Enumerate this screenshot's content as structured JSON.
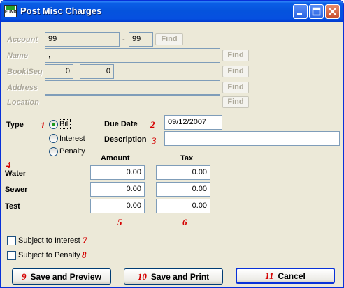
{
  "window": {
    "title": "Post Misc Charges",
    "icon_name": "fund-app-icon",
    "icon_text": "FUND",
    "controls": [
      "minimize-icon",
      "maximize-icon",
      "close-icon"
    ]
  },
  "lookup": {
    "account_label": "Account",
    "account_value": "99",
    "account_sep": "-",
    "account_suffix": "99",
    "name_label": "Name",
    "name_value": ",",
    "bookseq_label": "Book\\Seq",
    "book_value": "0",
    "seq_value": "0",
    "address_label": "Address",
    "address_value": "",
    "location_label": "Location",
    "location_value": "",
    "find_label": "Find"
  },
  "type": {
    "label": "Type",
    "marker": "1",
    "options": [
      "Bill",
      "Interest",
      "Penalty"
    ],
    "selected": "Bill"
  },
  "due_date": {
    "label": "Due Date",
    "marker": "2",
    "value": "09/12/2007"
  },
  "description": {
    "label": "Description",
    "marker": "3",
    "value": ""
  },
  "charges": {
    "rows_marker": "4",
    "amount_header": "Amount",
    "tax_header": "Tax",
    "amount_marker": "5",
    "tax_marker": "6",
    "rows": [
      {
        "label": "Water",
        "amount": "0.00",
        "tax": "0.00"
      },
      {
        "label": "Sewer",
        "amount": "0.00",
        "tax": "0.00"
      },
      {
        "label": "Test",
        "amount": "0.00",
        "tax": "0.00"
      }
    ]
  },
  "options": {
    "interest_label": "Subject to Interest",
    "interest_marker": "7",
    "penalty_label": "Subject to Penalty",
    "penalty_marker": "8"
  },
  "buttons": {
    "preview_marker": "9",
    "preview_label": "Save and Preview",
    "print_marker": "10",
    "print_label": "Save and Print",
    "cancel_marker": "11",
    "cancel_label": "Cancel"
  }
}
